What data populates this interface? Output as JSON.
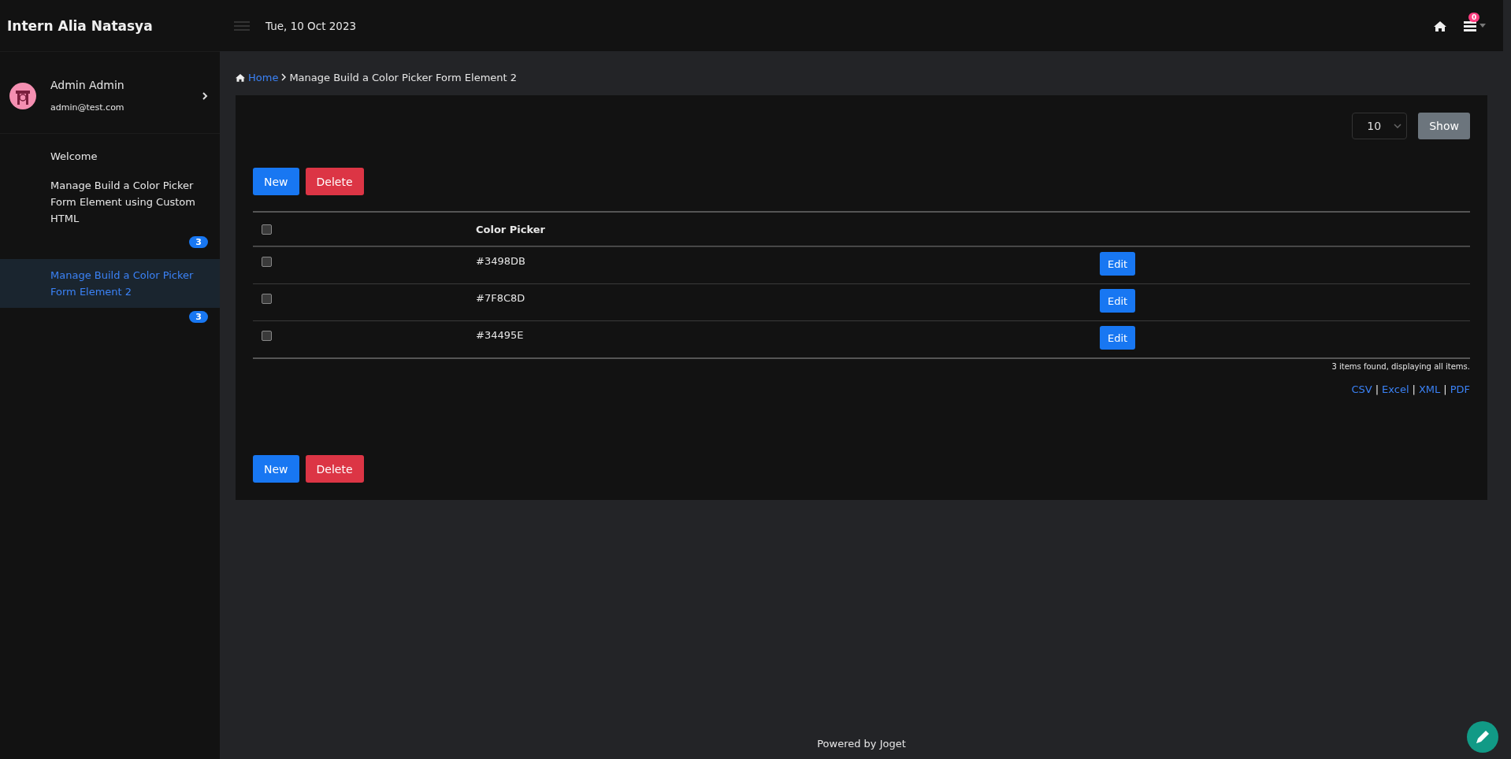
{
  "brand": "Intern Alia Natasya",
  "topbar": {
    "date": "Tue, 10 Oct 2023",
    "notification_count": "0"
  },
  "user": {
    "name": "Admin Admin",
    "email": "admin@test.com"
  },
  "menu": [
    {
      "label": "Welcome",
      "selected": false
    },
    {
      "label": "Manage Build a Color Picker Form Element using Custom HTML",
      "badge": "3",
      "selected": false
    },
    {
      "label": "Manage Build a Color Picker Form Element 2",
      "badge": "3",
      "selected": true
    }
  ],
  "breadcrumb": {
    "home": "Home",
    "current": "Manage Build a Color Picker Form Element 2"
  },
  "page_size": {
    "value": "10",
    "button": "Show"
  },
  "actions_top": [
    {
      "label": "New",
      "kind": "primary"
    },
    {
      "label": "Delete",
      "kind": "danger"
    }
  ],
  "table": {
    "header_checked": false,
    "columns": [
      "Color Picker"
    ],
    "rows": [
      {
        "value": "#3498DB",
        "checked": false,
        "action": "Edit"
      },
      {
        "value": "#7F8C8D",
        "checked": false,
        "action": "Edit"
      },
      {
        "value": "#34495E",
        "checked": false,
        "action": "Edit"
      }
    ]
  },
  "summary": "3 items found, displaying all items.",
  "exports": [
    "CSV",
    "Excel",
    "XML",
    "PDF"
  ],
  "export_separators": [
    "|",
    "|",
    "|"
  ],
  "actions_bottom": [
    {
      "label": "New",
      "kind": "primary"
    },
    {
      "label": "Delete",
      "kind": "danger"
    }
  ],
  "footer": "Powered by Joget"
}
